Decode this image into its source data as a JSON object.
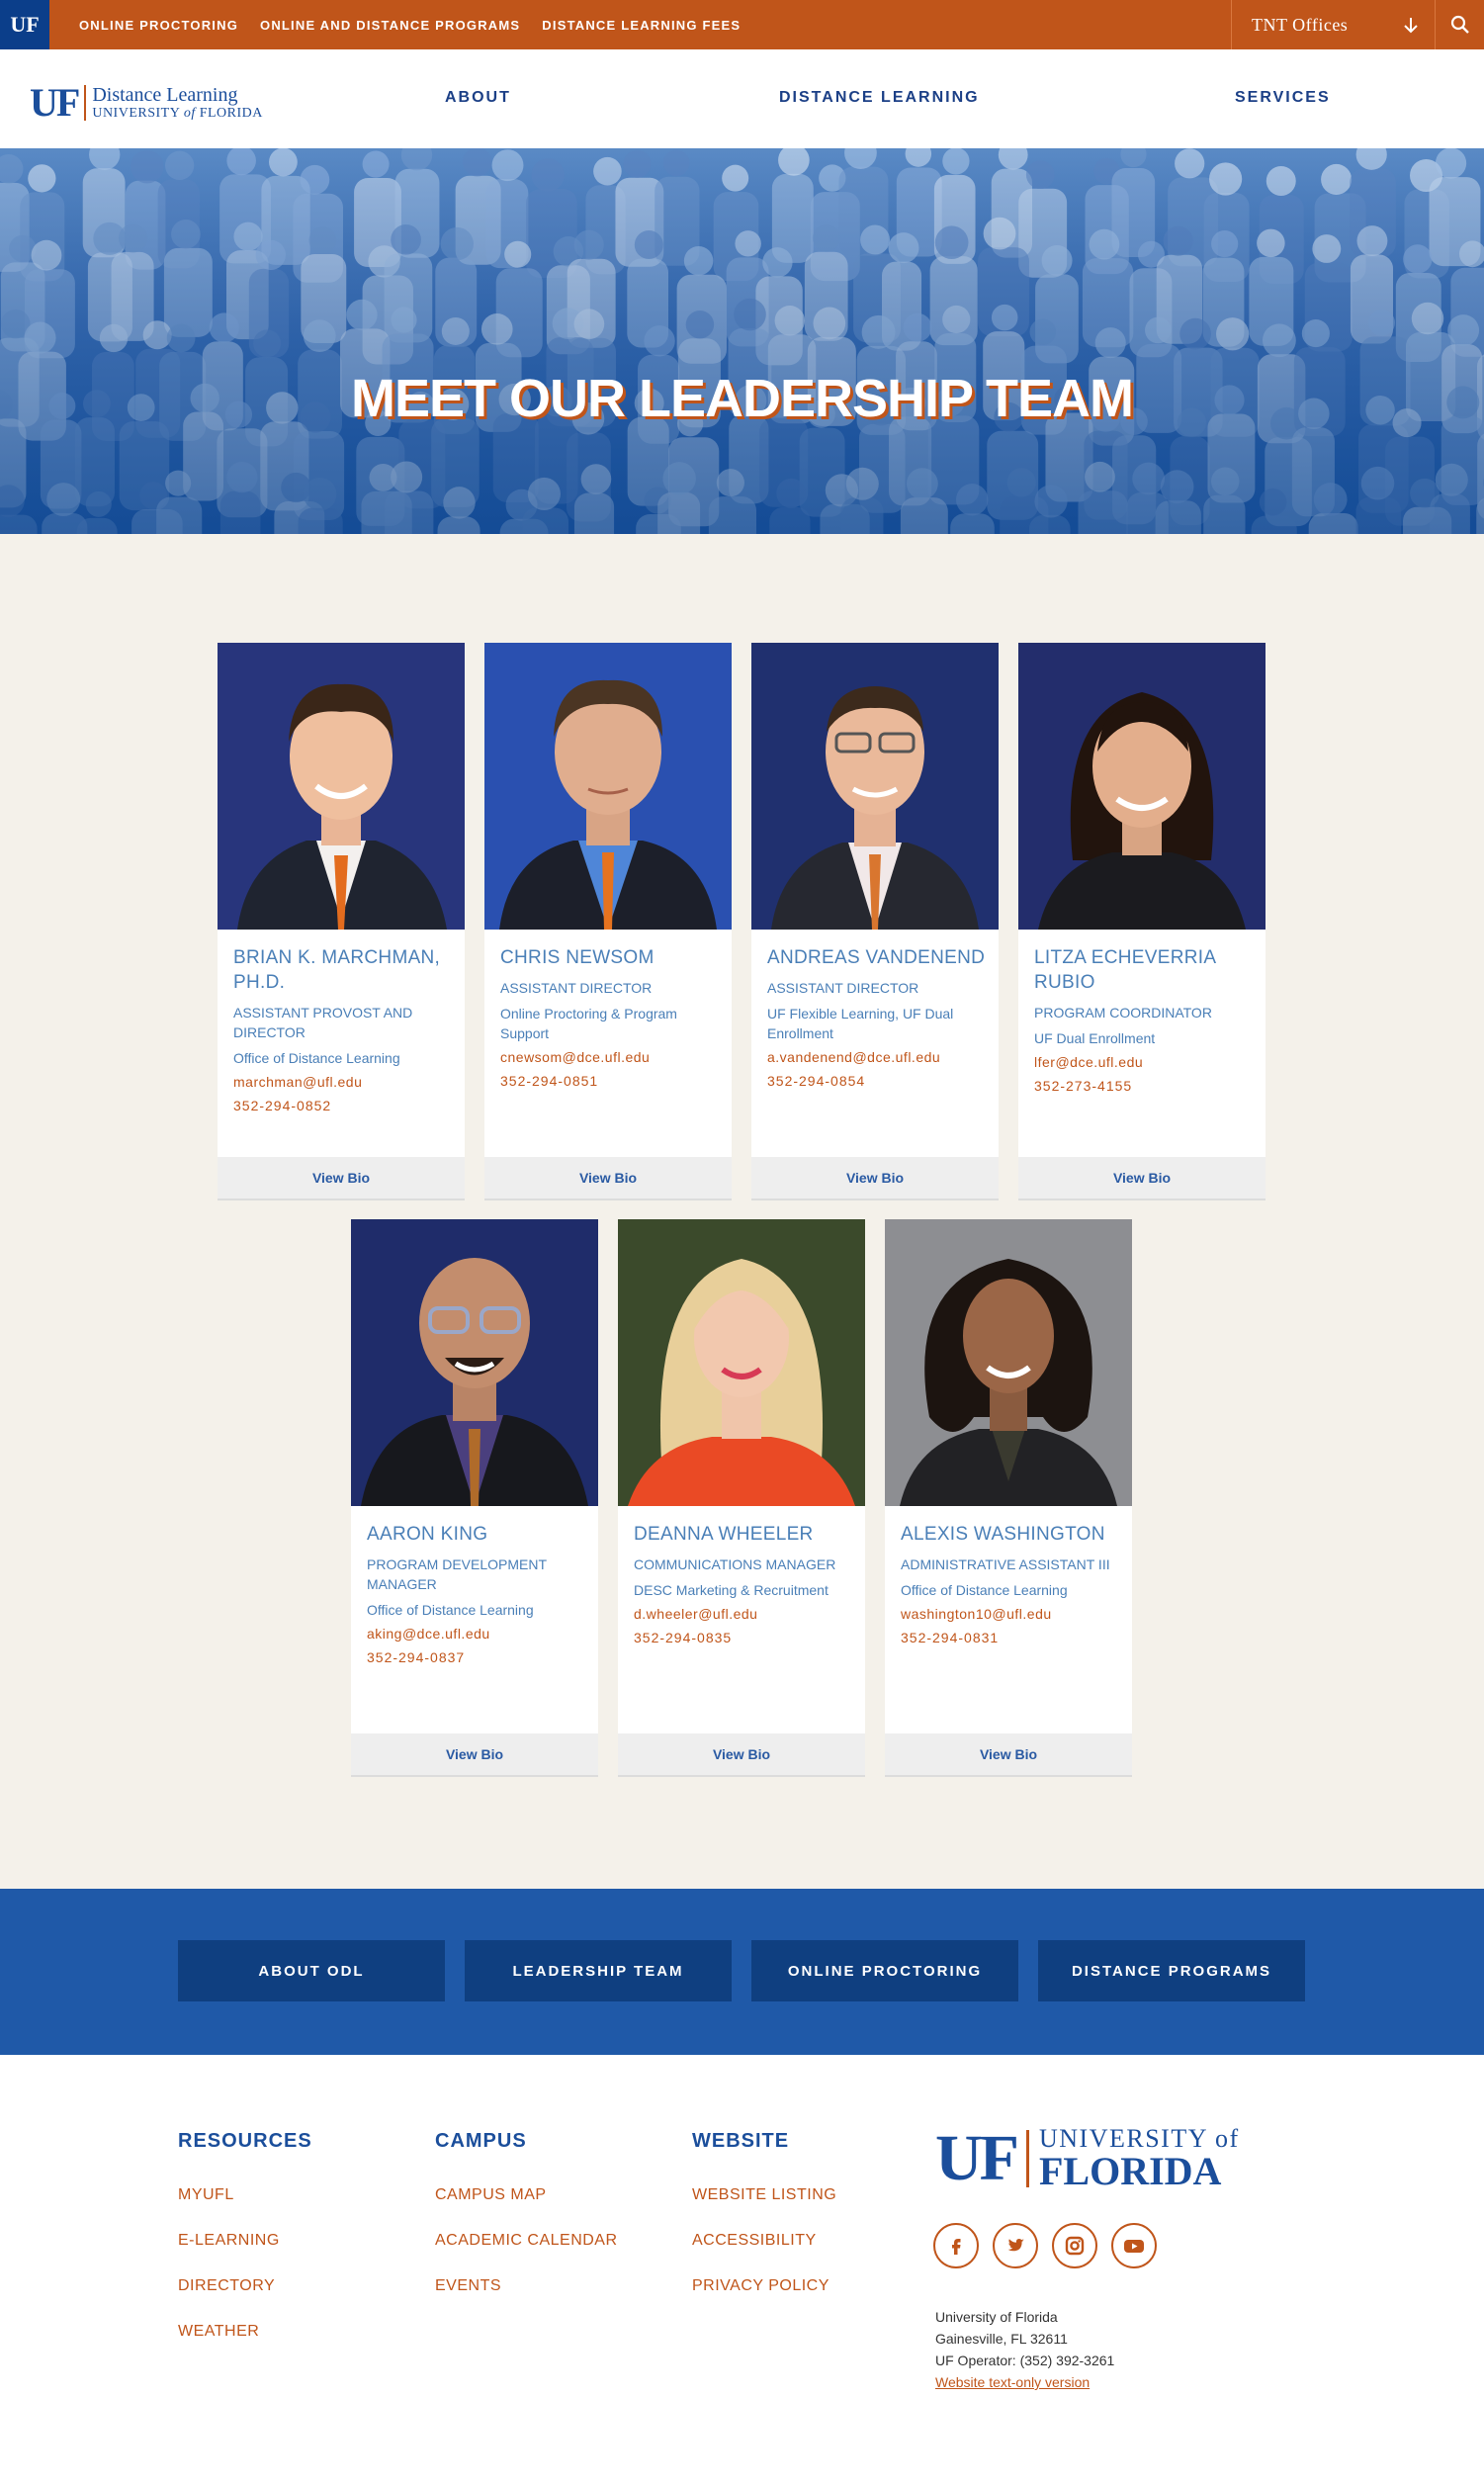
{
  "topbar": {
    "logo_text": "UF",
    "links": [
      "ONLINE PROCTORING",
      "ONLINE AND DISTANCE PROGRAMS",
      "DISTANCE LEARNING FEES"
    ],
    "offices_label": "TNT Offices",
    "offices_icon": "arrow-down-icon",
    "search_icon": "search-icon",
    "color": "#c0551a"
  },
  "header": {
    "logo": {
      "mark": "UF",
      "line1": "Distance Learning",
      "line2_pre": "UNIVERSITY ",
      "line2_of": "of",
      "line2_post": " FLORIDA"
    },
    "nav": [
      "ABOUT",
      "DISTANCE LEARNING",
      "SERVICES"
    ]
  },
  "hero": {
    "title": "MEET OUR LEADERSHIP TEAM"
  },
  "team": [
    {
      "name": "BRIAN K. MARCHMAN, PH.D.",
      "title": "ASSISTANT PROVOST AND DIRECTOR",
      "dept": "Office of Distance Learning",
      "email": "marchman@ufl.edu",
      "phone": "352-294-0852",
      "bio": "View Bio"
    },
    {
      "name": "CHRIS NEWSOM",
      "title": "ASSISTANT DIRECTOR",
      "dept": "Online Proctoring & Program Support",
      "email": "cnewsom@dce.ufl.edu",
      "phone": "352-294-0851",
      "bio": "View Bio"
    },
    {
      "name": "ANDREAS VANDENEND",
      "title": "ASSISTANT DIRECTOR",
      "dept": "UF Flexible Learning, UF Dual Enrollment",
      "email": "a.vandenend@dce.ufl.edu",
      "phone": "352-294-0854",
      "bio": "View Bio"
    },
    {
      "name": "LITZA ECHEVERRIA RUBIO",
      "title": "PROGRAM COORDINATOR",
      "dept": "UF Dual Enrollment",
      "email": "lfer@dce.ufl.edu",
      "phone": "352-273-4155",
      "bio": "View Bio"
    },
    {
      "name": "AARON KING",
      "title": "PROGRAM DEVELOPMENT MANAGER",
      "dept": "Office of Distance Learning",
      "email": "aking@dce.ufl.edu",
      "phone": "352-294-0837",
      "bio": "View Bio"
    },
    {
      "name": "DEANNA WHEELER",
      "title": "COMMUNICATIONS MANAGER",
      "dept": "DESC Marketing & Recruitment",
      "email": "d.wheeler@ufl.edu",
      "phone": "352-294-0835",
      "bio": "View Bio"
    },
    {
      "name": "ALEXIS WASHINGTON",
      "title": "ADMINISTRATIVE ASSISTANT III",
      "dept": "Office of Distance Learning",
      "email": "washington10@ufl.edu",
      "phone": "352-294-0831",
      "bio": "View Bio"
    }
  ],
  "quick_links": [
    "ABOUT ODL",
    "LEADERSHIP TEAM",
    "ONLINE PROCTORING",
    "DISTANCE PROGRAMS"
  ],
  "footer": {
    "resources": {
      "heading": "RESOURCES",
      "links": [
        "MYUFL",
        "E-LEARNING",
        "DIRECTORY",
        "WEATHER"
      ]
    },
    "campus": {
      "heading": "CAMPUS",
      "links": [
        "CAMPUS MAP",
        "ACADEMIC CALENDAR",
        "EVENTS"
      ]
    },
    "website": {
      "heading": "WEBSITE",
      "links": [
        "WEBSITE LISTING",
        "ACCESSIBILITY",
        "PRIVACY POLICY"
      ]
    },
    "logo": {
      "mark": "UF",
      "w1": "UNIVERSITY of",
      "w2": "FLORIDA"
    },
    "social": [
      "facebook-icon",
      "twitter-icon",
      "instagram-icon",
      "youtube-icon"
    ],
    "address": [
      "University of Florida",
      "Gainesville, FL 32611",
      "UF Operator: (352) 392-3261"
    ],
    "text_only_link": "Website text-only version"
  },
  "colors": {
    "orange": "#c0551a",
    "blue": "#1b4e9b",
    "band": "#1f59a8"
  }
}
